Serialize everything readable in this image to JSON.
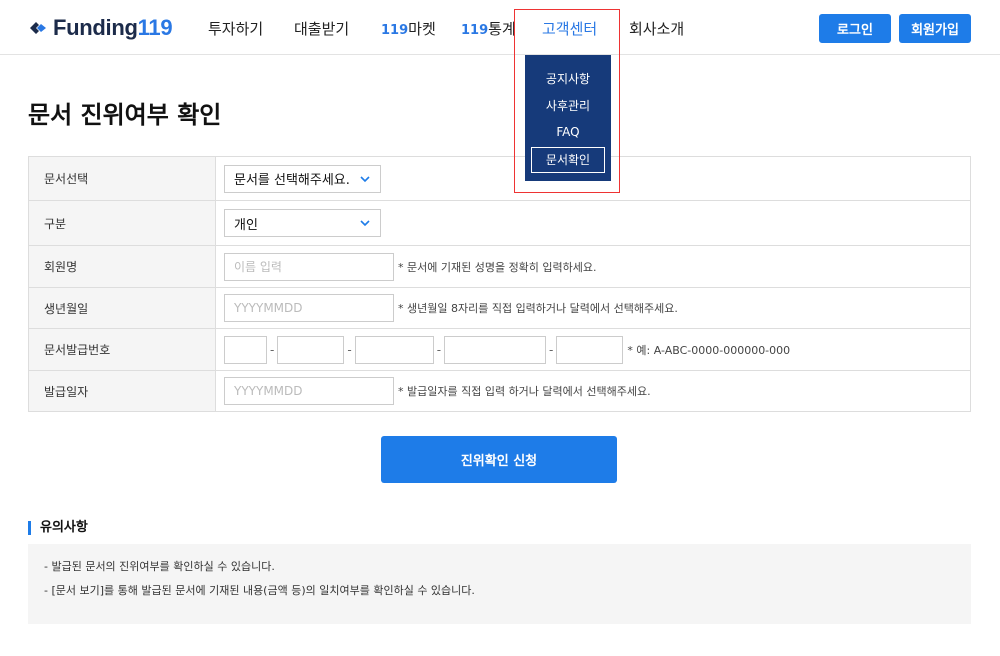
{
  "brand": {
    "name": "Funding",
    "number": "119"
  },
  "nav": {
    "items": [
      {
        "label": "투자하기"
      },
      {
        "label": "대출받기"
      },
      {
        "prefix": "119",
        "label": "마켓"
      },
      {
        "prefix": "119",
        "label": "통계"
      },
      {
        "label": "고객센터"
      },
      {
        "label": "회사소개"
      }
    ],
    "login": "로그인",
    "signup": "회원가입"
  },
  "dropdown": {
    "items": [
      "공지사항",
      "사후관리",
      "FAQ",
      "문서확인"
    ],
    "selected": "문서확인"
  },
  "page": {
    "title": "문서 진위여부 확인"
  },
  "form": {
    "rows": [
      {
        "label": "문서선택",
        "value": "문서를 선택해주세요."
      },
      {
        "label": "구분",
        "value": "개인"
      },
      {
        "label": "회원명",
        "placeholder": "이름 입력",
        "hint": "* 문서에 기재된 성명을 정확히 입력하세요."
      },
      {
        "label": "생년월일",
        "placeholder": "YYYYMMDD",
        "hint": "* 생년월일 8자리를 직접 입력하거나 달력에서 선택해주세요."
      },
      {
        "label": "문서발급번호",
        "separator": "-",
        "hint": "* 예: A-ABC-0000-000000-000"
      },
      {
        "label": "발급일자",
        "placeholder": "YYYYMMDD",
        "hint": "* 발급일자를 직접 입력 하거나 달력에서 선택해주세요."
      }
    ],
    "submit": "진위확인 신청"
  },
  "notice": {
    "title": "유의사항",
    "lines": [
      "- 발급된 문서의 진위여부를 확인하실 수 있습니다.",
      "- [문서 보기]를 통해 발급된 문서에 기재된 내용(금액 등)의 일치여부를 확인하실 수 있습니다."
    ]
  },
  "colors": {
    "accent": "#1e7ce8",
    "dropdown_bg": "#163a7a",
    "highlight": "#ee3333"
  }
}
